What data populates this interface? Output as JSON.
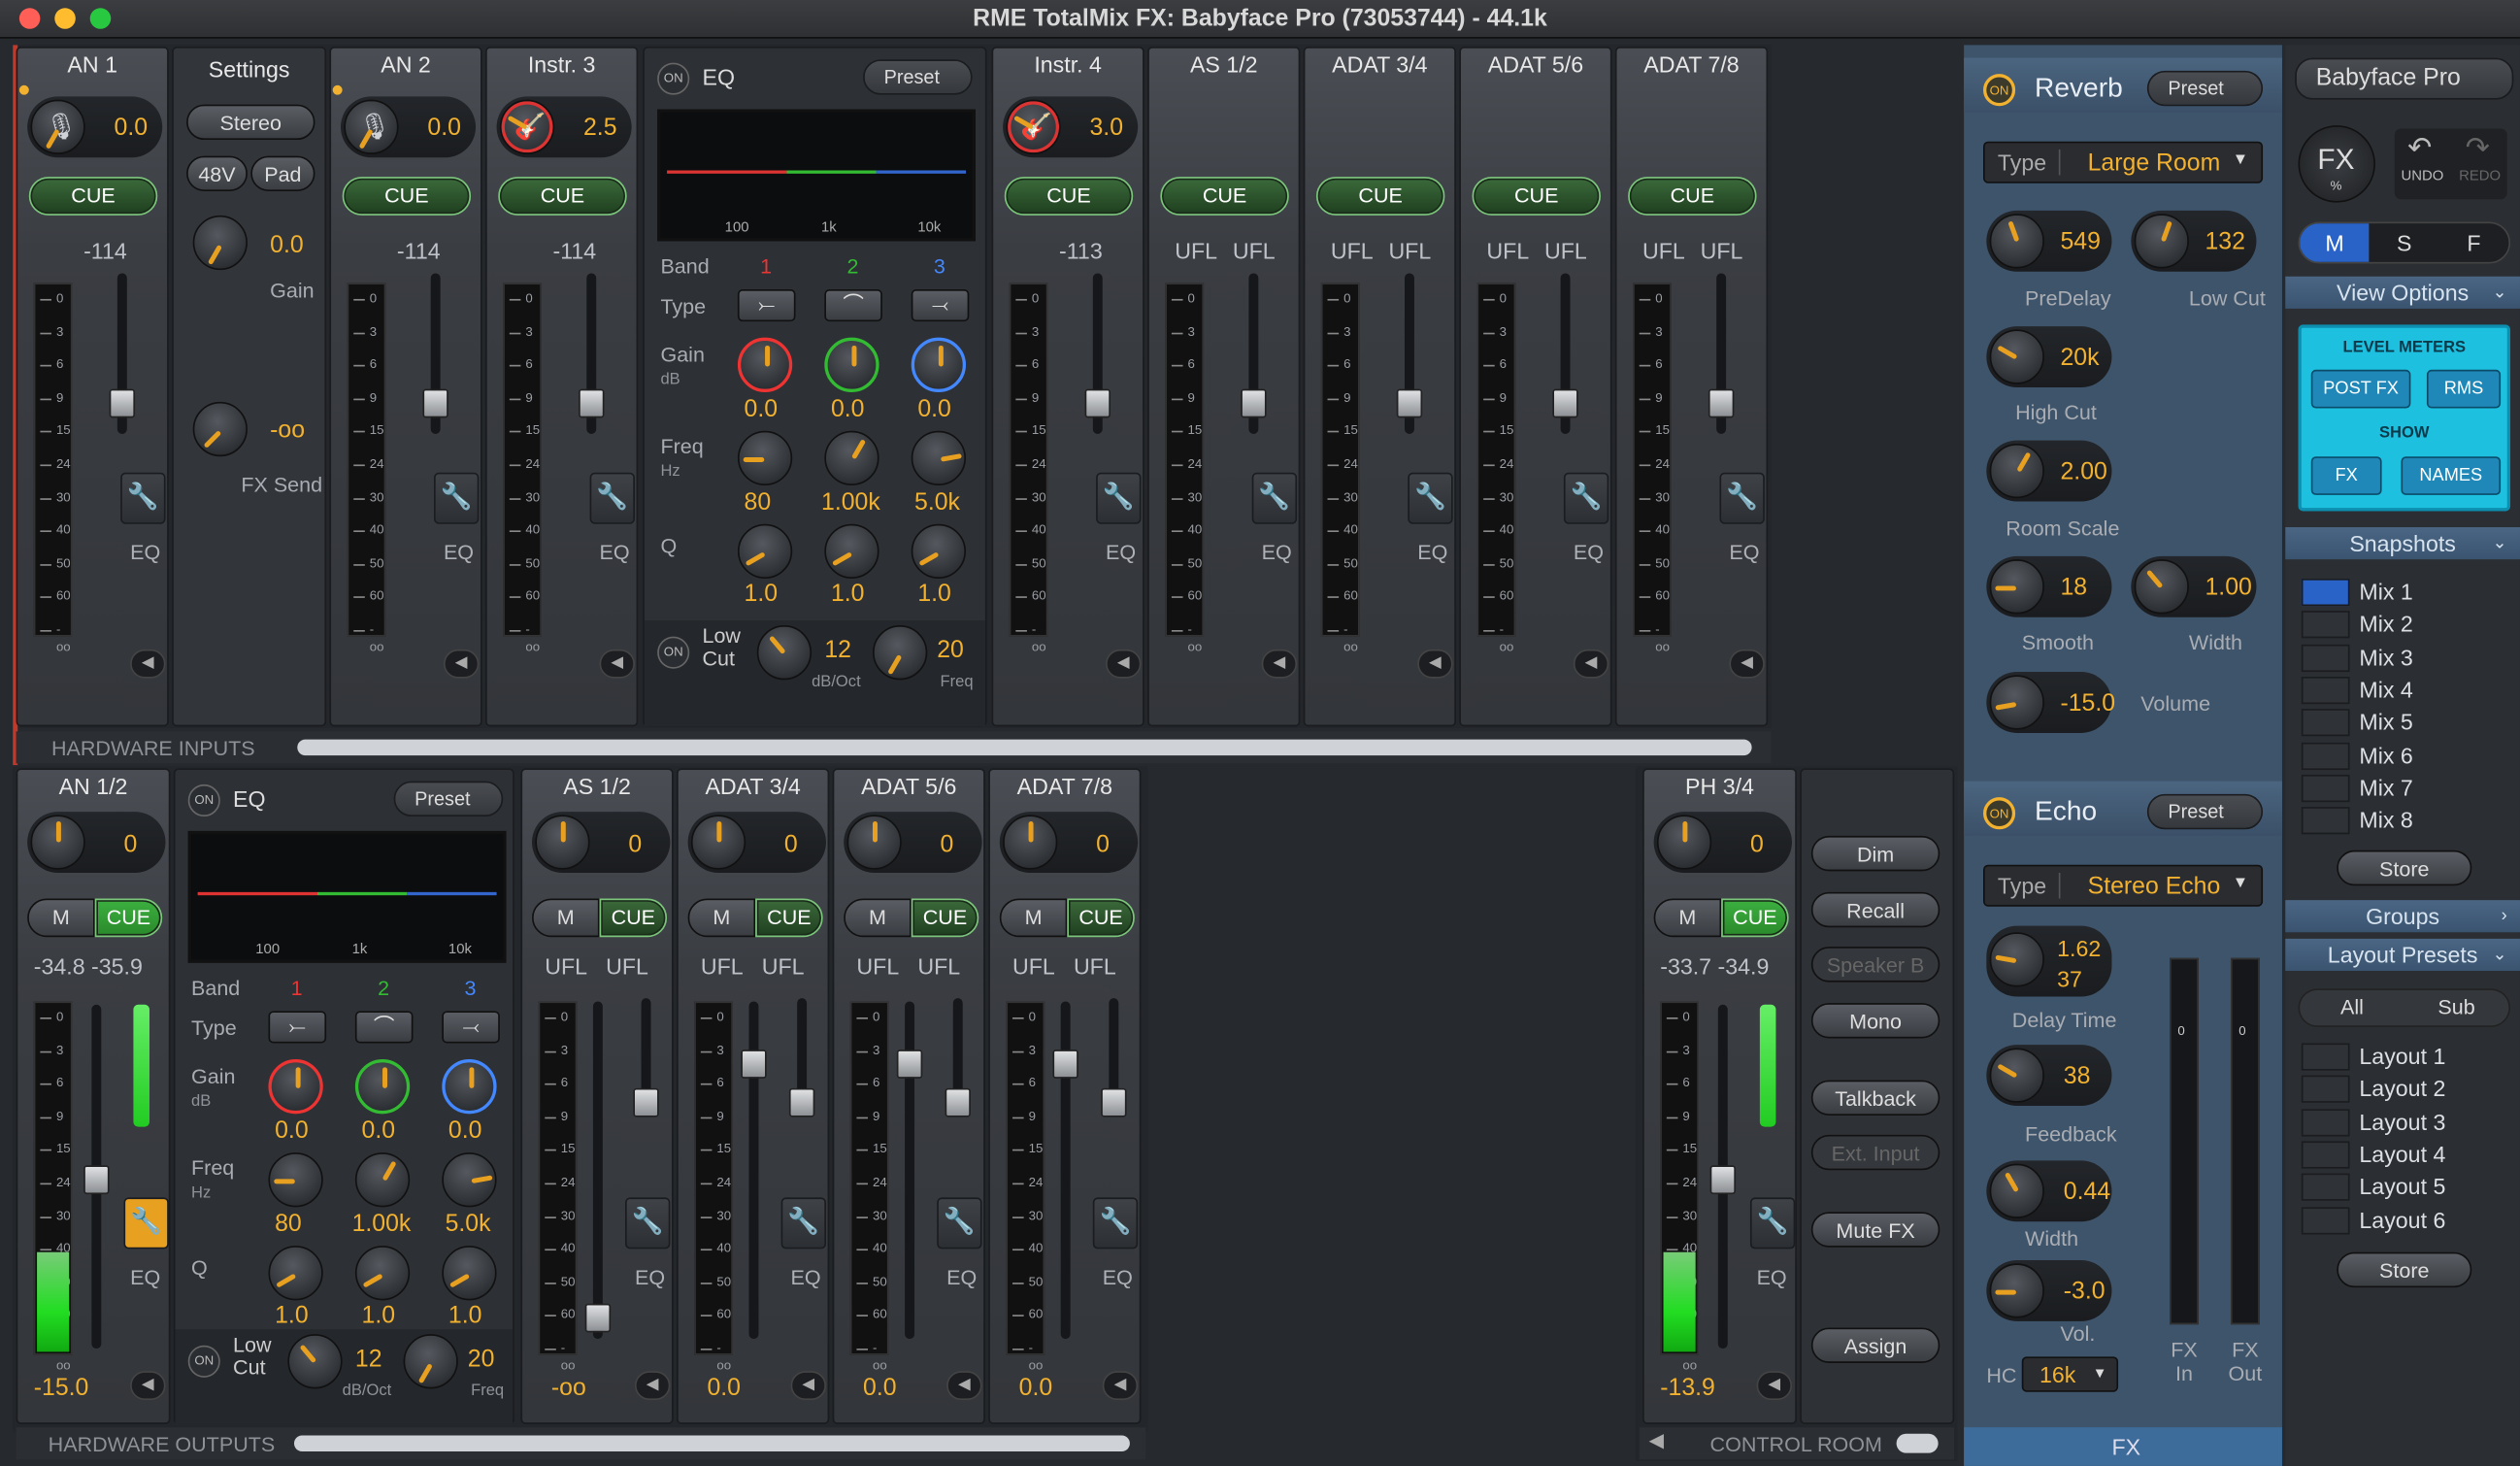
{
  "window": {
    "title": "RME TotalMix FX: Babyface Pro (73053744) - 44.1k"
  },
  "inputs": {
    "channels": [
      {
        "name": "AN 1",
        "gain": "0.0",
        "level": "-114"
      },
      {
        "name": "AN 2",
        "gain": "0.0",
        "level": "-114"
      },
      {
        "name": "Instr. 3",
        "gain": "2.5",
        "level": "-114"
      },
      {
        "name": "Instr. 4",
        "gain": "3.0",
        "level": "-113"
      },
      {
        "name": "AS 1/2",
        "l": "UFL",
        "r": "UFL"
      },
      {
        "name": "ADAT 3/4",
        "l": "UFL",
        "r": "UFL"
      },
      {
        "name": "ADAT 5/6",
        "l": "UFL",
        "r": "UFL"
      },
      {
        "name": "ADAT 7/8",
        "l": "UFL",
        "r": "UFL"
      }
    ],
    "settings": {
      "title": "Settings",
      "stereo": "Stereo",
      "p48v": "48V",
      "pad": "Pad",
      "gain_value": "0.0",
      "gain_label": "Gain",
      "fxsend_value": "-oo",
      "fxsend_label": "FX Send"
    },
    "cue_label": "CUE",
    "eq_label": "EQ",
    "section_label": "HARDWARE INPUTS"
  },
  "meter_scale": [
    "0",
    "3",
    "6",
    "9",
    "15",
    "24",
    "30",
    "40",
    "50",
    "60",
    "-oo"
  ],
  "eq_top": {
    "on": "ON",
    "title": "EQ",
    "preset": "Preset",
    "band_label": "Band",
    "bands": [
      "1",
      "2",
      "3"
    ],
    "type_label": "Type",
    "gain_label": "Gain",
    "gain_unit": "dB",
    "gains": [
      "0.0",
      "0.0",
      "0.0"
    ],
    "freq_label": "Freq",
    "freq_unit": "Hz",
    "freqs": [
      "80",
      "1.00k",
      "5.0k"
    ],
    "q_label": "Q",
    "qs": [
      "1.0",
      "1.0",
      "1.0"
    ],
    "lowcut": "Low Cut",
    "lowcut_slope": "12",
    "lowcut_slope_label": "dB/Oct",
    "lowcut_freq": "20",
    "lowcut_freq_label": "Freq",
    "screen_ticks": [
      "100",
      "1k",
      "10k"
    ]
  },
  "outputs": {
    "main": {
      "name": "AN 1/2",
      "pan": "0",
      "mute": "M",
      "cue": "CUE",
      "level": "-34.8 -35.9",
      "volume": "-15.0"
    },
    "channels": [
      {
        "name": "AS 1/2",
        "pan": "0",
        "l": "UFL",
        "r": "UFL",
        "volume": "-oo"
      },
      {
        "name": "ADAT 3/4",
        "pan": "0",
        "l": "UFL",
        "r": "UFL",
        "volume": "0.0"
      },
      {
        "name": "ADAT 5/6",
        "pan": "0",
        "l": "UFL",
        "r": "UFL",
        "volume": "0.0"
      },
      {
        "name": "ADAT 7/8",
        "pan": "0",
        "l": "UFL",
        "r": "UFL",
        "volume": "0.0"
      }
    ],
    "phones": {
      "name": "PH 3/4",
      "pan": "0",
      "mute": "M",
      "cue": "CUE",
      "level": "-33.7 -34.9",
      "volume": "-13.9"
    },
    "section_label": "HARDWARE OUTPUTS"
  },
  "eq_bottom": {
    "on": "ON",
    "title": "EQ",
    "preset": "Preset",
    "band_label": "Band",
    "bands": [
      "1",
      "2",
      "3"
    ],
    "type_label": "Type",
    "gain_label": "Gain",
    "gain_unit": "dB",
    "gains": [
      "0.0",
      "0.0",
      "0.0"
    ],
    "freq_label": "Freq",
    "freq_unit": "Hz",
    "freqs": [
      "80",
      "1.00k",
      "5.0k"
    ],
    "q_label": "Q",
    "qs": [
      "1.0",
      "1.0",
      "1.0"
    ],
    "lowcut": "Low Cut",
    "lowcut_slope": "12",
    "lowcut_slope_label": "dB/Oct",
    "lowcut_freq": "20",
    "lowcut_freq_label": "Freq",
    "screen_ticks": [
      "100",
      "1k",
      "10k"
    ]
  },
  "control_room": {
    "label": "CONTROL ROOM",
    "buttons": [
      "Dim",
      "Recall",
      "Speaker B",
      "Mono",
      "Talkback",
      "Ext. Input",
      "Mute FX",
      "Assign"
    ]
  },
  "reverb": {
    "on": "ON",
    "title": "Reverb",
    "preset": "Preset",
    "type_label": "Type",
    "type": "Large Room",
    "predelay": "549",
    "predelay_label": "PreDelay",
    "lowcut": "132",
    "lowcut_label": "Low Cut",
    "highcut": "20k",
    "highcut_label": "High Cut",
    "roomscale": "2.00",
    "roomscale_label": "Room Scale",
    "smooth": "18",
    "smooth_label": "Smooth",
    "width": "1.00",
    "width_label": "Width",
    "volume": "-15.0",
    "volume_label": "Volume"
  },
  "echo": {
    "on": "ON",
    "title": "Echo",
    "preset": "Preset",
    "type_label": "Type",
    "type": "Stereo Echo",
    "delaytime": "1.62\n37",
    "delaytime_a": "1.62",
    "delaytime_b": "37",
    "delaytime_label": "Delay Time",
    "feedback": "38",
    "feedback_label": "Feedback",
    "width": "0.44",
    "width_label": "Width",
    "vol": "-3.0",
    "vol_label": "Vol.",
    "hc_label": "HC",
    "hc": "16k",
    "fxin": "FX In",
    "fxout": "FX Out"
  },
  "fx_footer": "FX",
  "right": {
    "device": "Babyface Pro",
    "fx": "FX",
    "fx_pct": "%",
    "undo": "UNDO",
    "redo": "REDO",
    "msf": [
      "M",
      "S",
      "F"
    ],
    "view_options": "View Options",
    "level_meters": "LEVEL METERS",
    "post_fx": "POST FX",
    "rms": "RMS",
    "show": "SHOW",
    "fx_btn": "FX",
    "names": "NAMES",
    "snapshots": "Snapshots",
    "snaps": [
      "Mix 1",
      "Mix 2",
      "Mix 3",
      "Mix 4",
      "Mix 5",
      "Mix 6",
      "Mix 7",
      "Mix 8"
    ],
    "store": "Store",
    "groups": "Groups",
    "layout_presets": "Layout Presets",
    "all": "All",
    "sub": "Sub",
    "layouts": [
      "Layout 1",
      "Layout 2",
      "Layout 3",
      "Layout 4",
      "Layout 5",
      "Layout 6"
    ],
    "store2": "Store"
  },
  "colors": {
    "accent": "#f2b230",
    "cue_green": "#2fa336",
    "fx_blue": "#3e546b",
    "cyan": "#22c8e6"
  }
}
